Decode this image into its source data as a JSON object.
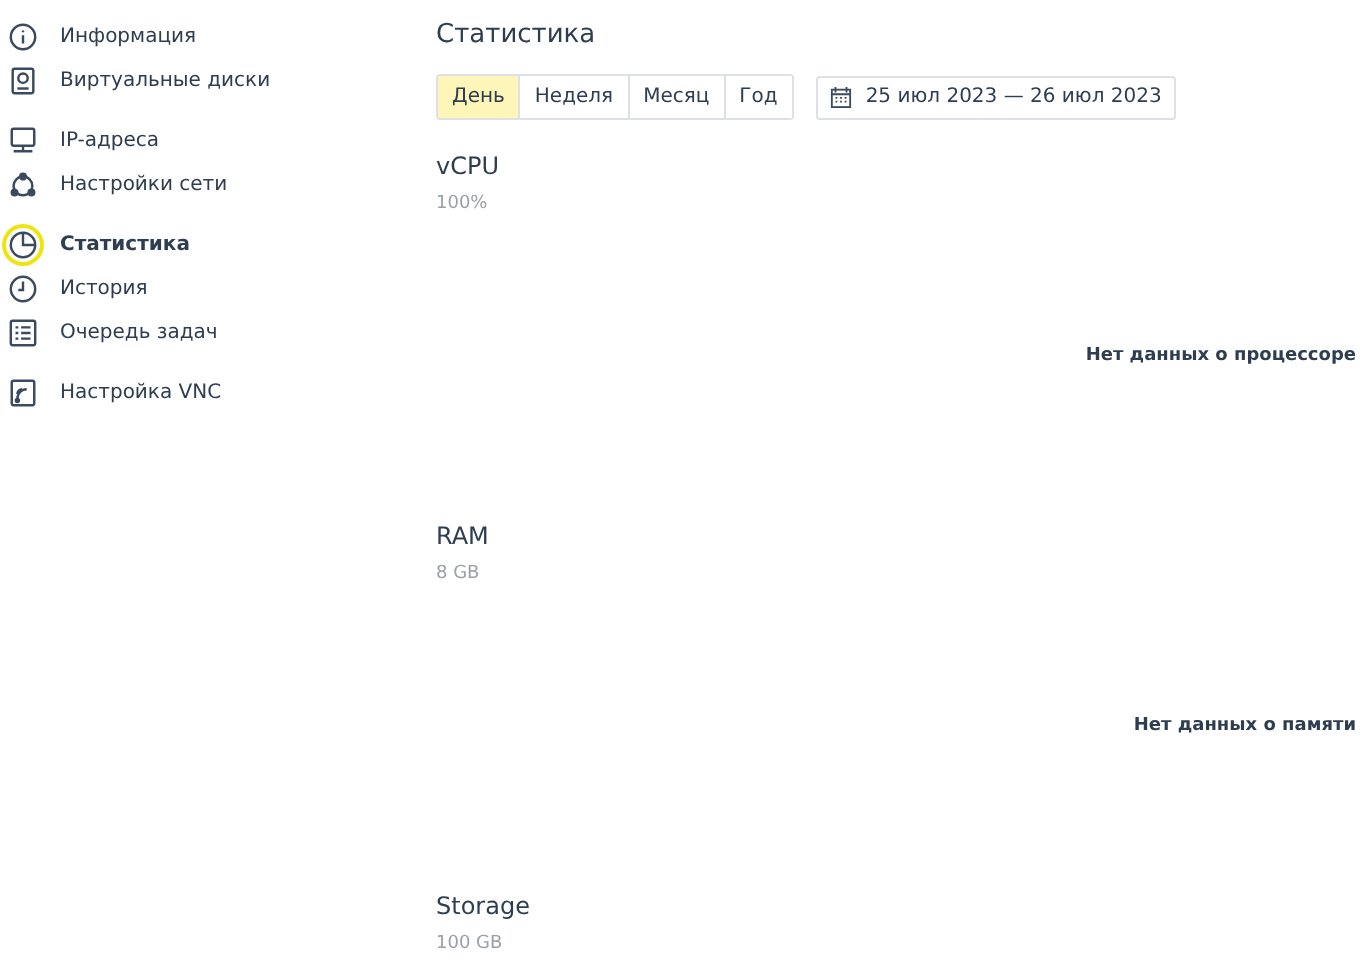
{
  "sidebar": {
    "groups": [
      {
        "items": [
          {
            "label": "Информация",
            "selected": false
          },
          {
            "label": "Виртуальные диски",
            "selected": false
          }
        ]
      },
      {
        "items": [
          {
            "label": "IP-адреса",
            "selected": false
          },
          {
            "label": "Настройки сети",
            "selected": false
          }
        ]
      },
      {
        "items": [
          {
            "label": "Статистика",
            "selected": true
          },
          {
            "label": "История",
            "selected": false
          },
          {
            "label": "Очередь задач",
            "selected": false
          }
        ]
      },
      {
        "items": [
          {
            "label": "Настройка VNC",
            "selected": false
          }
        ]
      }
    ]
  },
  "page": {
    "title": "Статистика",
    "periods": [
      {
        "label": "День",
        "selected": true
      },
      {
        "label": "Неделя",
        "selected": false
      },
      {
        "label": "Месяц",
        "selected": false
      },
      {
        "label": "Год",
        "selected": false
      }
    ],
    "date_range": "25 июл 2023 — 26 июл 2023",
    "sections": [
      {
        "title": "vCPU",
        "capacity": "100%",
        "message": "Нет данных о процессоре"
      },
      {
        "title": "RAM",
        "capacity": "8 GB",
        "message": "Нет данных о памяти"
      },
      {
        "title": "Storage",
        "capacity": "100 GB"
      }
    ]
  }
}
